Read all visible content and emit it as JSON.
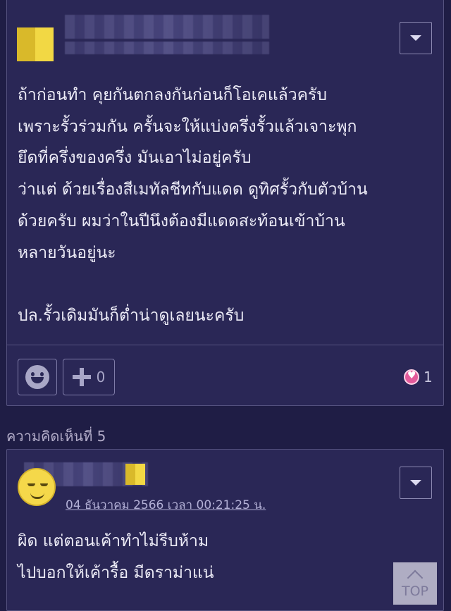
{
  "comment1": {
    "body": "ถ้าก่อนทำ คุยกันตกลงกันก่อนก็โอเคแล้วครับ\nเพราะรั้วร่วมกัน ครั้นจะให้แบ่งครึ่งรั้วแล้วเจาะพุก\nยึดที่ครึ่งของครึ่ง มันเอาไม่อยู่ครับ\nว่าแต่ ด้วยเรื่องสีเมทัลชีทกับแดด ดูทิศรั้วกับตัวบ้าน\nด้วยครับ ผมว่าในปีนึงต้องมีแดดสะท้อนเข้าบ้าน\nหลายวันอยู่นะ\n\nปล.รั้วเดิมมันก็ต่ำน่าดูเลยนะครับ",
    "plus_count": "0",
    "like_count": "1"
  },
  "section_label": "ความคิดเห็นที่ 5",
  "comment2": {
    "timestamp": "04 ธันวาคม 2566 เวลา 00:21:25 น.",
    "body": "ผิด แต่ตอนเค้าทำไม่รีบห้าม\nไปบอกให้เค้ารื้อ มีดราม่าแน่"
  },
  "top_button": {
    "label": "TOP"
  },
  "icons": {
    "emoji": "smile-emoji-icon",
    "plus": "plus-icon",
    "heart": "heart-icon",
    "dropdown": "chevron-down-icon",
    "top": "chevron-up-icon"
  }
}
